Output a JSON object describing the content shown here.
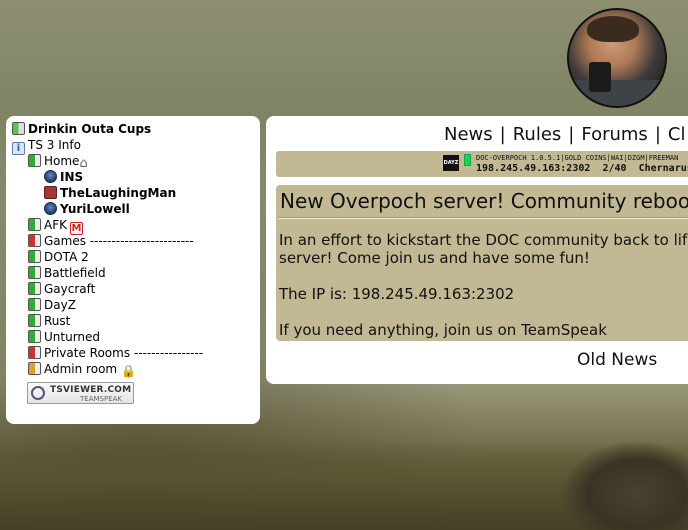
{
  "avatar": {
    "alt": "avatar"
  },
  "teamspeak": {
    "server_name": "Drinkin Outa Cups",
    "info_label": "TS 3 Info",
    "channels": [
      {
        "label": "Home",
        "icon": "home-icon",
        "users": [
          "INS",
          "TheLaughingMan",
          "YuriLowell"
        ]
      },
      {
        "label": "AFK",
        "icon": "moderator-icon",
        "badge": "M"
      },
      {
        "label": "Games ------------------------"
      },
      {
        "label": "DOTA 2"
      },
      {
        "label": "Battlefield"
      },
      {
        "label": "Gaycraft"
      },
      {
        "label": "DayZ"
      },
      {
        "label": "Rust"
      },
      {
        "label": "Unturned"
      },
      {
        "label": "Private Rooms ----------------"
      },
      {
        "label": "Admin room",
        "icon": "lock-icon"
      }
    ],
    "tsviewer": {
      "brand": "TSVIEWER.COM",
      "sub": "TEAMSPEAK"
    }
  },
  "nav": {
    "items": [
      "News",
      "Rules",
      "Forums",
      "Cl"
    ],
    "separator": "|"
  },
  "server_status": {
    "game_icon": "dayz-icon",
    "game_logo_text": "DAYZ",
    "status_color": "#2bd12b",
    "line1": "DOC-OVERPOCH 1.0.5.1|GOLD COINS|WAI|DZGM|FREEMAN",
    "ip": "198.245.49.163:2302",
    "players": "2/40",
    "map": "Chernarus"
  },
  "news": {
    "title": "New Overpoch server! Community reboo",
    "p1_line1": "In an effort to kickstart the DOC community back to life",
    "p1_line2": "server! Come join us and have some fun!",
    "p2": "The IP is: 198.245.49.163:2302",
    "p3": "If you need anything, join us on TeamSpeak",
    "old_news_label": "Old News"
  },
  "colors": {
    "panel_tan": "#c2b994",
    "panel_bg": "#ffffff"
  }
}
